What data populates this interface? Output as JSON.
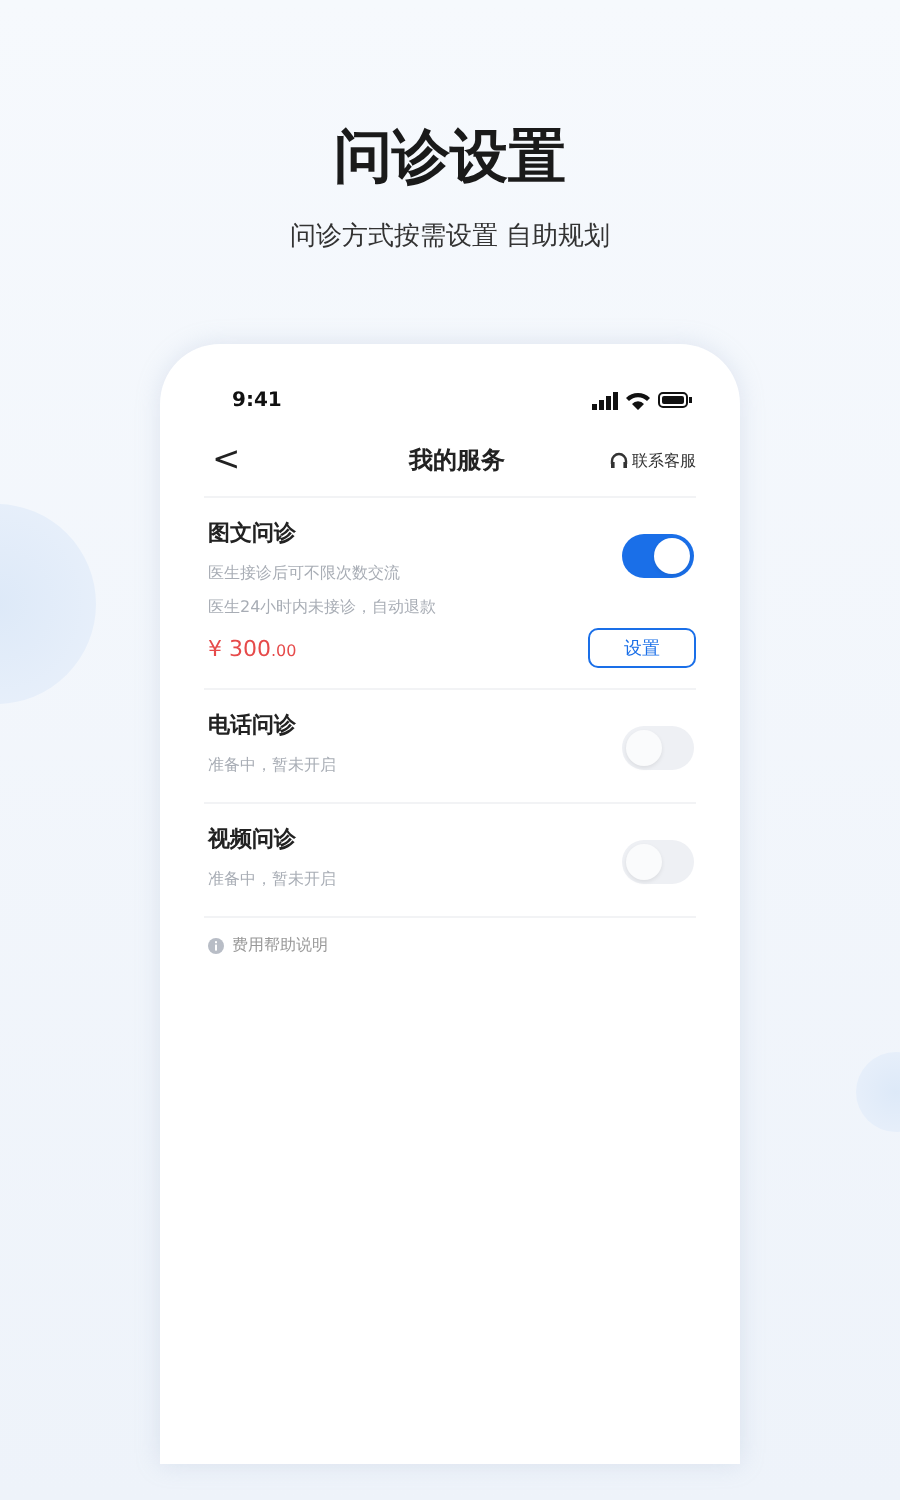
{
  "header": {
    "title": "问诊设置",
    "subtitle": "问诊方式按需设置 自助规划"
  },
  "status_bar": {
    "time": "9:41"
  },
  "nav": {
    "back": "<",
    "title": "我的服务",
    "support": "联系客服"
  },
  "services": [
    {
      "title": "图文问诊",
      "lines": [
        "医生接诊后可不限次数交流",
        "医生24小时内未接诊，自动退款"
      ],
      "on": true,
      "price": "¥ 300",
      "price_decimals": ".00",
      "button": "设置"
    },
    {
      "title": "电话问诊",
      "lines": [
        "准备中，暂未开启"
      ],
      "on": false
    },
    {
      "title": "视频问诊",
      "lines": [
        "准备中，暂未开启"
      ],
      "on": false
    }
  ],
  "help": "费用帮助说明"
}
